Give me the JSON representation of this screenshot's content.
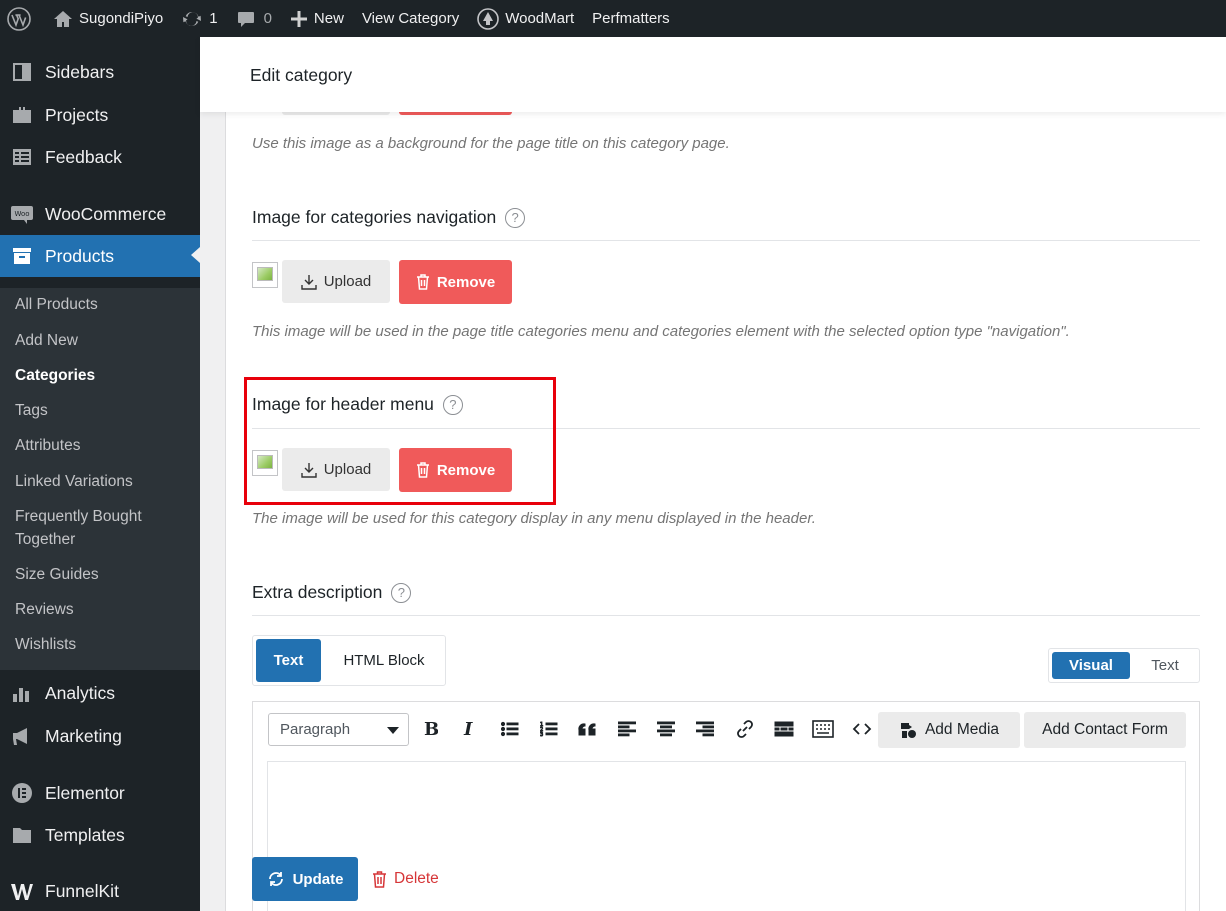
{
  "admin_bar": {
    "site_name": "SugondiPiyo",
    "updates_count": "1",
    "comments_count": "0",
    "new_label": "New",
    "view_category_label": "View Category",
    "woodmart_label": "WoodMart",
    "perfmatters_label": "Perfmatters"
  },
  "sidebar": {
    "items": [
      {
        "label": "Sidebars",
        "icon": "sidebar-icon"
      },
      {
        "label": "Projects",
        "icon": "briefcase-icon"
      },
      {
        "label": "Feedback",
        "icon": "feedback-icon"
      },
      {
        "label": "WooCommerce",
        "icon": "woo-icon"
      },
      {
        "label": "Products",
        "icon": "archive-icon"
      },
      {
        "label": "Analytics",
        "icon": "bar-chart-icon"
      },
      {
        "label": "Marketing",
        "icon": "megaphone-icon"
      },
      {
        "label": "Elementor",
        "icon": "elementor-icon"
      },
      {
        "label": "Templates",
        "icon": "folder-icon"
      },
      {
        "label": "FunnelKit",
        "icon": "funnelkit-icon"
      }
    ],
    "submenu": [
      "All Products",
      "Add New",
      "Categories",
      "Tags",
      "Attributes",
      "Linked Variations",
      "Frequently Bought Together",
      "Size Guides",
      "Reviews",
      "Wishlists"
    ],
    "active_submenu": "Categories"
  },
  "header": {
    "title": "Edit category"
  },
  "content": {
    "page_title_image_hint": "Use this image as a background for the page title on this category page.",
    "nav_image": {
      "title": "Image for categories navigation",
      "upload_label": "Upload",
      "remove_label": "Remove",
      "hint": "This image will be used in the page title categories menu and categories element with the selected option type \"navigation\"."
    },
    "header_menu_image": {
      "title": "Image for header menu",
      "upload_label": "Upload",
      "remove_label": "Remove",
      "hint": "The image will be used for this category display in any menu displayed in the header."
    },
    "extra_description": {
      "title": "Extra description",
      "tabs": [
        "Text",
        "HTML Block"
      ],
      "active_tab": "Text",
      "editor_modes": [
        "Visual",
        "Text"
      ],
      "active_mode": "Visual",
      "format_select": "Paragraph",
      "add_media_label": "Add Media",
      "add_contact_form_label": "Add Contact Form"
    }
  },
  "actions": {
    "update_label": "Update",
    "delete_label": "Delete"
  },
  "colors": {
    "admin_bg": "#1d2327",
    "accent_blue": "#2271b1",
    "remove_red": "#f05a5a",
    "highlight_red": "#e8000b",
    "delete_red": "#d63638"
  }
}
